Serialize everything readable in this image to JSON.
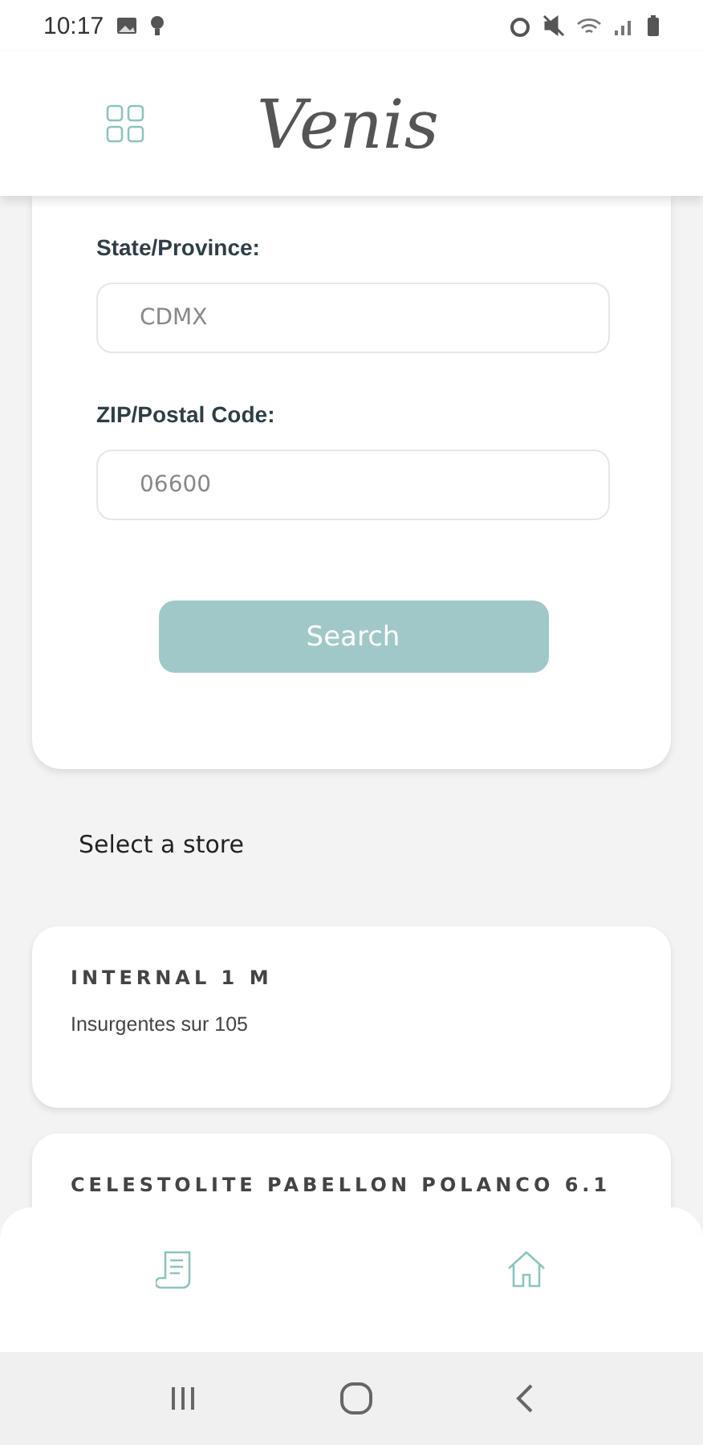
{
  "status_bar": {
    "time": "10:17"
  },
  "header": {
    "logo": "Venis"
  },
  "form": {
    "fields": [
      {
        "label": "State/Province:",
        "value": "CDMX"
      },
      {
        "label": "ZIP/Postal Code:",
        "value": "06600"
      }
    ],
    "button": "Search"
  },
  "stores_heading": "Select a store",
  "stores": [
    {
      "name": "INTERNAL 1 M",
      "address": "Insurgentes sur 105"
    },
    {
      "name": "CELESTOLITE PABELLON POLANCO 6.1"
    }
  ]
}
